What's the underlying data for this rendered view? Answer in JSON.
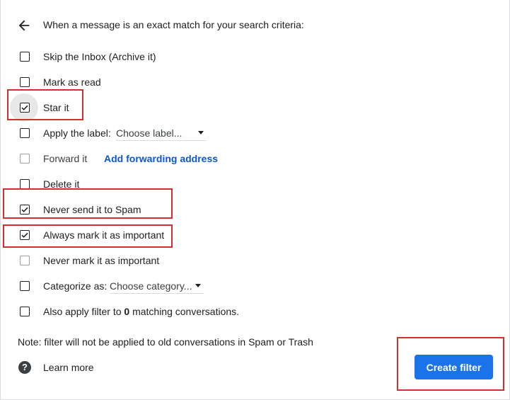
{
  "header": {
    "text": "When a message is an exact match for your search criteria:"
  },
  "options": [
    {
      "label": "Skip the Inbox (Archive it)",
      "checked": false
    },
    {
      "label": "Mark as read",
      "checked": false
    },
    {
      "label": "Star it",
      "checked": true
    },
    {
      "label": "Apply the label:",
      "checked": false,
      "select_value": "Choose label..."
    },
    {
      "label": "Forward it",
      "checked": false,
      "disabled": true,
      "link": "Add forwarding address"
    },
    {
      "label": "Delete it",
      "checked": false
    },
    {
      "label": "Never send it to Spam",
      "checked": true
    },
    {
      "label": "Always mark it as important",
      "checked": true
    },
    {
      "label": "Never mark it as important",
      "checked": false,
      "disabled": true
    },
    {
      "label": "Categorize as:",
      "checked": false,
      "select_value": "Choose category..."
    }
  ],
  "also_apply": {
    "prefix": "Also apply filter to ",
    "count": "0",
    "suffix": " matching conversations."
  },
  "note": "Note: filter will not be applied to old conversations in Spam or Trash",
  "learn_more": "Learn more",
  "create_button": "Create filter",
  "colors": {
    "accent": "#1a73e8",
    "link": "#0b57d0",
    "highlight": "#d32f2f"
  }
}
